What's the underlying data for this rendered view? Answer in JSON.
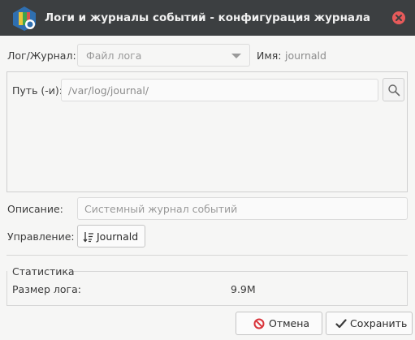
{
  "window": {
    "title": "Логи и журналы событий - конфигурация журнала",
    "icons": {
      "app": "journal-app-icon",
      "close": "close-icon"
    },
    "colors": {
      "titlebar": "#3c3f41",
      "close": "#e75a5a",
      "cancel_icon": "#d9343b",
      "ok_icon": "#3b3b3b"
    }
  },
  "form": {
    "log_label": "Лог/Журнал:",
    "log_type_value": "Файл лога",
    "name_label": "Имя:",
    "name_value": "journald",
    "path_label": "Путь (-и):",
    "path_value": "/var/log/journal/",
    "description_label": "Описание:",
    "description_placeholder": "Системный журнал событий",
    "management_label": "Управление:",
    "management_button": "Journald"
  },
  "stats": {
    "title": "Статистика",
    "size_label": "Размер лога:",
    "size_value": "9.9M"
  },
  "buttons": {
    "cancel": "Отмена",
    "save": "Сохранить"
  }
}
